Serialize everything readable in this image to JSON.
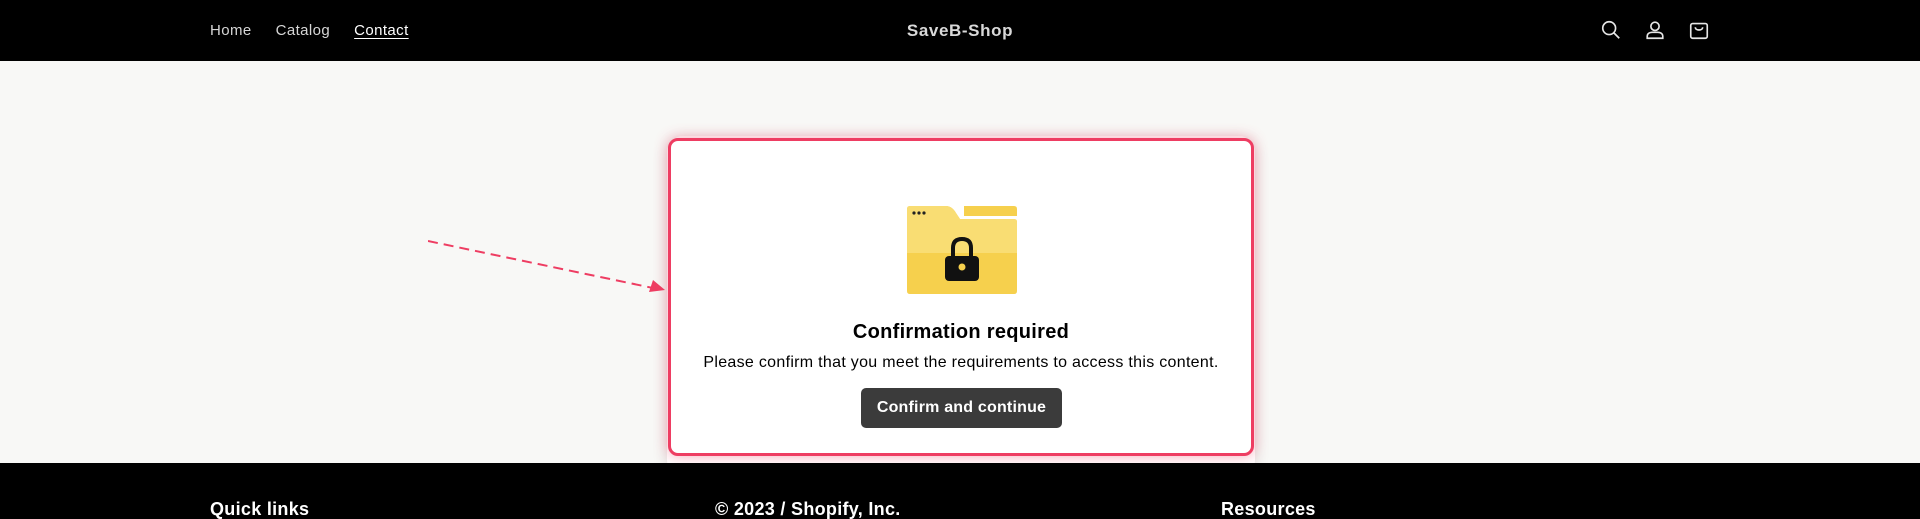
{
  "header": {
    "nav": [
      {
        "label": "Home",
        "active": false
      },
      {
        "label": "Catalog",
        "active": false
      },
      {
        "label": "Contact",
        "active": true
      }
    ],
    "brand": "SaveB-Shop",
    "icons": [
      "search-icon",
      "account-icon",
      "cart-icon"
    ]
  },
  "modal": {
    "icon": "locked-folder-icon",
    "title": "Confirmation required",
    "text": "Please confirm that you meet the requirements to access this content.",
    "button_label": "Confirm and continue",
    "highlight_color": "#ee3d62"
  },
  "footer": {
    "quick_links": "Quick links",
    "copyright": "© 2023 / Shopify, Inc.",
    "resources": "Resources"
  },
  "colors": {
    "header_bg": "#000000",
    "page_bg": "#f8f8f6",
    "button_bg": "#3b3b3b",
    "folder_yellow": "#f6d04d"
  }
}
